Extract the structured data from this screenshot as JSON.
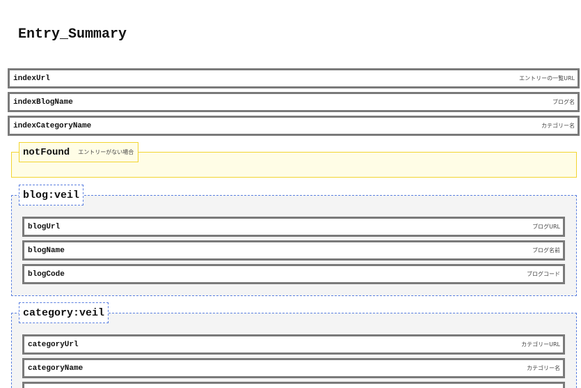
{
  "page": {
    "title": "Entry_Summary"
  },
  "top_vars": [
    {
      "name": "indexUrl",
      "desc": "エントリーの一覧URL"
    },
    {
      "name": "indexBlogName",
      "desc": "ブログ名"
    },
    {
      "name": "indexCategoryName",
      "desc": "カテゴリー名"
    }
  ],
  "not_found": {
    "name": "notFound",
    "desc": "エントリーがない場合"
  },
  "blog_veil": {
    "name": "blog:veil",
    "vars": [
      {
        "name": "blogUrl",
        "desc": "ブログURL"
      },
      {
        "name": "blogName",
        "desc": "ブログ名前"
      },
      {
        "name": "blogCode",
        "desc": "ブログコード"
      }
    ]
  },
  "category_veil": {
    "name": "category:veil",
    "vars": [
      {
        "name": "categoryUrl",
        "desc": "カテゴリーURL"
      },
      {
        "name": "categoryName",
        "desc": "カテゴリー名"
      }
    ]
  },
  "colors": {
    "row_border": "#7a7a7a",
    "notfound_border": "#f2d530",
    "notfound_bg": "#fffde6",
    "veil_border": "#5a7fe0",
    "veil_bg": "#f4f4f4"
  }
}
